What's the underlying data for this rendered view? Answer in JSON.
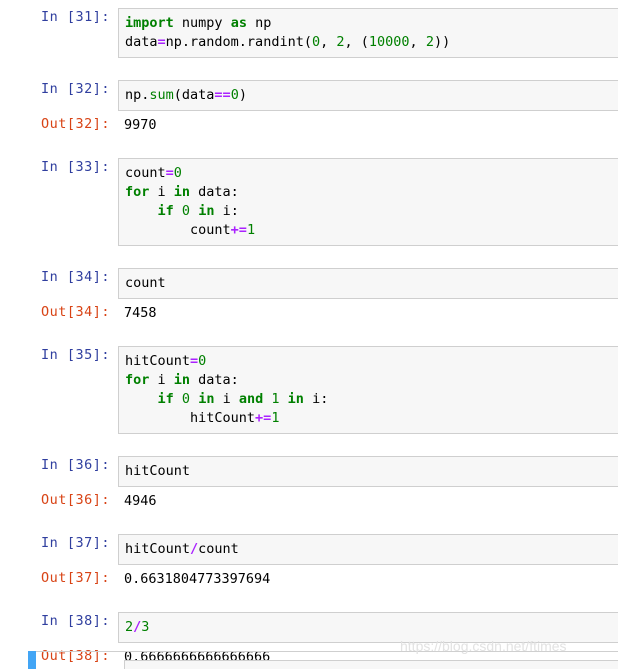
{
  "notebook": {
    "cells": [
      {
        "prompt_in": "In [31]:",
        "code_lines": [
          [
            {
              "t": "import",
              "c": "kw"
            },
            {
              "t": " numpy ",
              "c": "pl"
            },
            {
              "t": "as",
              "c": "kw"
            },
            {
              "t": " np",
              "c": "pl"
            }
          ],
          [
            {
              "t": "data",
              "c": "pl"
            },
            {
              "t": "=",
              "c": "op"
            },
            {
              "t": "np.random.randint(",
              "c": "pl"
            },
            {
              "t": "0",
              "c": "num"
            },
            {
              "t": ", ",
              "c": "pl"
            },
            {
              "t": "2",
              "c": "num"
            },
            {
              "t": ", (",
              "c": "pl"
            },
            {
              "t": "10000",
              "c": "num"
            },
            {
              "t": ", ",
              "c": "pl"
            },
            {
              "t": "2",
              "c": "num"
            },
            {
              "t": "))",
              "c": "pl"
            }
          ]
        ],
        "has_output": false
      },
      {
        "prompt_in": "In [32]:",
        "code_lines": [
          [
            {
              "t": "np.",
              "c": "pl"
            },
            {
              "t": "sum",
              "c": "bi"
            },
            {
              "t": "(data",
              "c": "pl"
            },
            {
              "t": "==",
              "c": "op"
            },
            {
              "t": "0",
              "c": "num"
            },
            {
              "t": ")",
              "c": "pl"
            }
          ]
        ],
        "has_output": true,
        "prompt_out": "Out[32]:",
        "output_text": "9970"
      },
      {
        "prompt_in": "In [33]:",
        "code_lines": [
          [
            {
              "t": "count",
              "c": "pl"
            },
            {
              "t": "=",
              "c": "op"
            },
            {
              "t": "0",
              "c": "num"
            }
          ],
          [
            {
              "t": "for",
              "c": "kw"
            },
            {
              "t": " i ",
              "c": "pl"
            },
            {
              "t": "in",
              "c": "kw"
            },
            {
              "t": " data:",
              "c": "pl"
            }
          ],
          [
            {
              "t": "    ",
              "c": "pl"
            },
            {
              "t": "if",
              "c": "kw"
            },
            {
              "t": " ",
              "c": "pl"
            },
            {
              "t": "0",
              "c": "num"
            },
            {
              "t": " ",
              "c": "pl"
            },
            {
              "t": "in",
              "c": "kw"
            },
            {
              "t": " i:",
              "c": "pl"
            }
          ],
          [
            {
              "t": "        count",
              "c": "pl"
            },
            {
              "t": "+=",
              "c": "op"
            },
            {
              "t": "1",
              "c": "num"
            }
          ]
        ],
        "has_output": false
      },
      {
        "prompt_in": "In [34]:",
        "code_lines": [
          [
            {
              "t": "count",
              "c": "pl"
            }
          ]
        ],
        "has_output": true,
        "prompt_out": "Out[34]:",
        "output_text": "7458"
      },
      {
        "prompt_in": "In [35]:",
        "code_lines": [
          [
            {
              "t": "hitCount",
              "c": "pl"
            },
            {
              "t": "=",
              "c": "op"
            },
            {
              "t": "0",
              "c": "num"
            }
          ],
          [
            {
              "t": "for",
              "c": "kw"
            },
            {
              "t": " i ",
              "c": "pl"
            },
            {
              "t": "in",
              "c": "kw"
            },
            {
              "t": " data:",
              "c": "pl"
            }
          ],
          [
            {
              "t": "    ",
              "c": "pl"
            },
            {
              "t": "if",
              "c": "kw"
            },
            {
              "t": " ",
              "c": "pl"
            },
            {
              "t": "0",
              "c": "num"
            },
            {
              "t": " ",
              "c": "pl"
            },
            {
              "t": "in",
              "c": "kw"
            },
            {
              "t": " i ",
              "c": "pl"
            },
            {
              "t": "and",
              "c": "kw"
            },
            {
              "t": " ",
              "c": "pl"
            },
            {
              "t": "1",
              "c": "num"
            },
            {
              "t": " ",
              "c": "pl"
            },
            {
              "t": "in",
              "c": "kw"
            },
            {
              "t": " i:",
              "c": "pl"
            }
          ],
          [
            {
              "t": "        hitCount",
              "c": "pl"
            },
            {
              "t": "+=",
              "c": "op"
            },
            {
              "t": "1",
              "c": "num"
            }
          ]
        ],
        "has_output": false
      },
      {
        "prompt_in": "In [36]:",
        "code_lines": [
          [
            {
              "t": "hitCount",
              "c": "pl"
            }
          ]
        ],
        "has_output": true,
        "prompt_out": "Out[36]:",
        "output_text": "4946"
      },
      {
        "prompt_in": "In [37]:",
        "code_lines": [
          [
            {
              "t": "hitCount",
              "c": "pl"
            },
            {
              "t": "/",
              "c": "op"
            },
            {
              "t": "count",
              "c": "pl"
            }
          ]
        ],
        "has_output": true,
        "prompt_out": "Out[37]:",
        "output_text": "0.6631804773397694"
      },
      {
        "prompt_in": "In [38]:",
        "code_lines": [
          [
            {
              "t": "2",
              "c": "num"
            },
            {
              "t": "/",
              "c": "op"
            },
            {
              "t": "3",
              "c": "num"
            }
          ]
        ],
        "has_output": true,
        "prompt_out": "Out[38]:",
        "output_text": "0.6666666666666666"
      }
    ]
  },
  "watermark": {
    "text": "https://blog.csdn.net/ftimes"
  },
  "colors": {
    "prompt_in": "#303F9F",
    "prompt_out": "#D84315",
    "keyword": "#008000",
    "number": "#008000",
    "operator": "#AA22FF",
    "cell_bg": "#f7f7f7",
    "cell_border": "#cfcfcf",
    "selection_bar": "#42A5F5"
  }
}
